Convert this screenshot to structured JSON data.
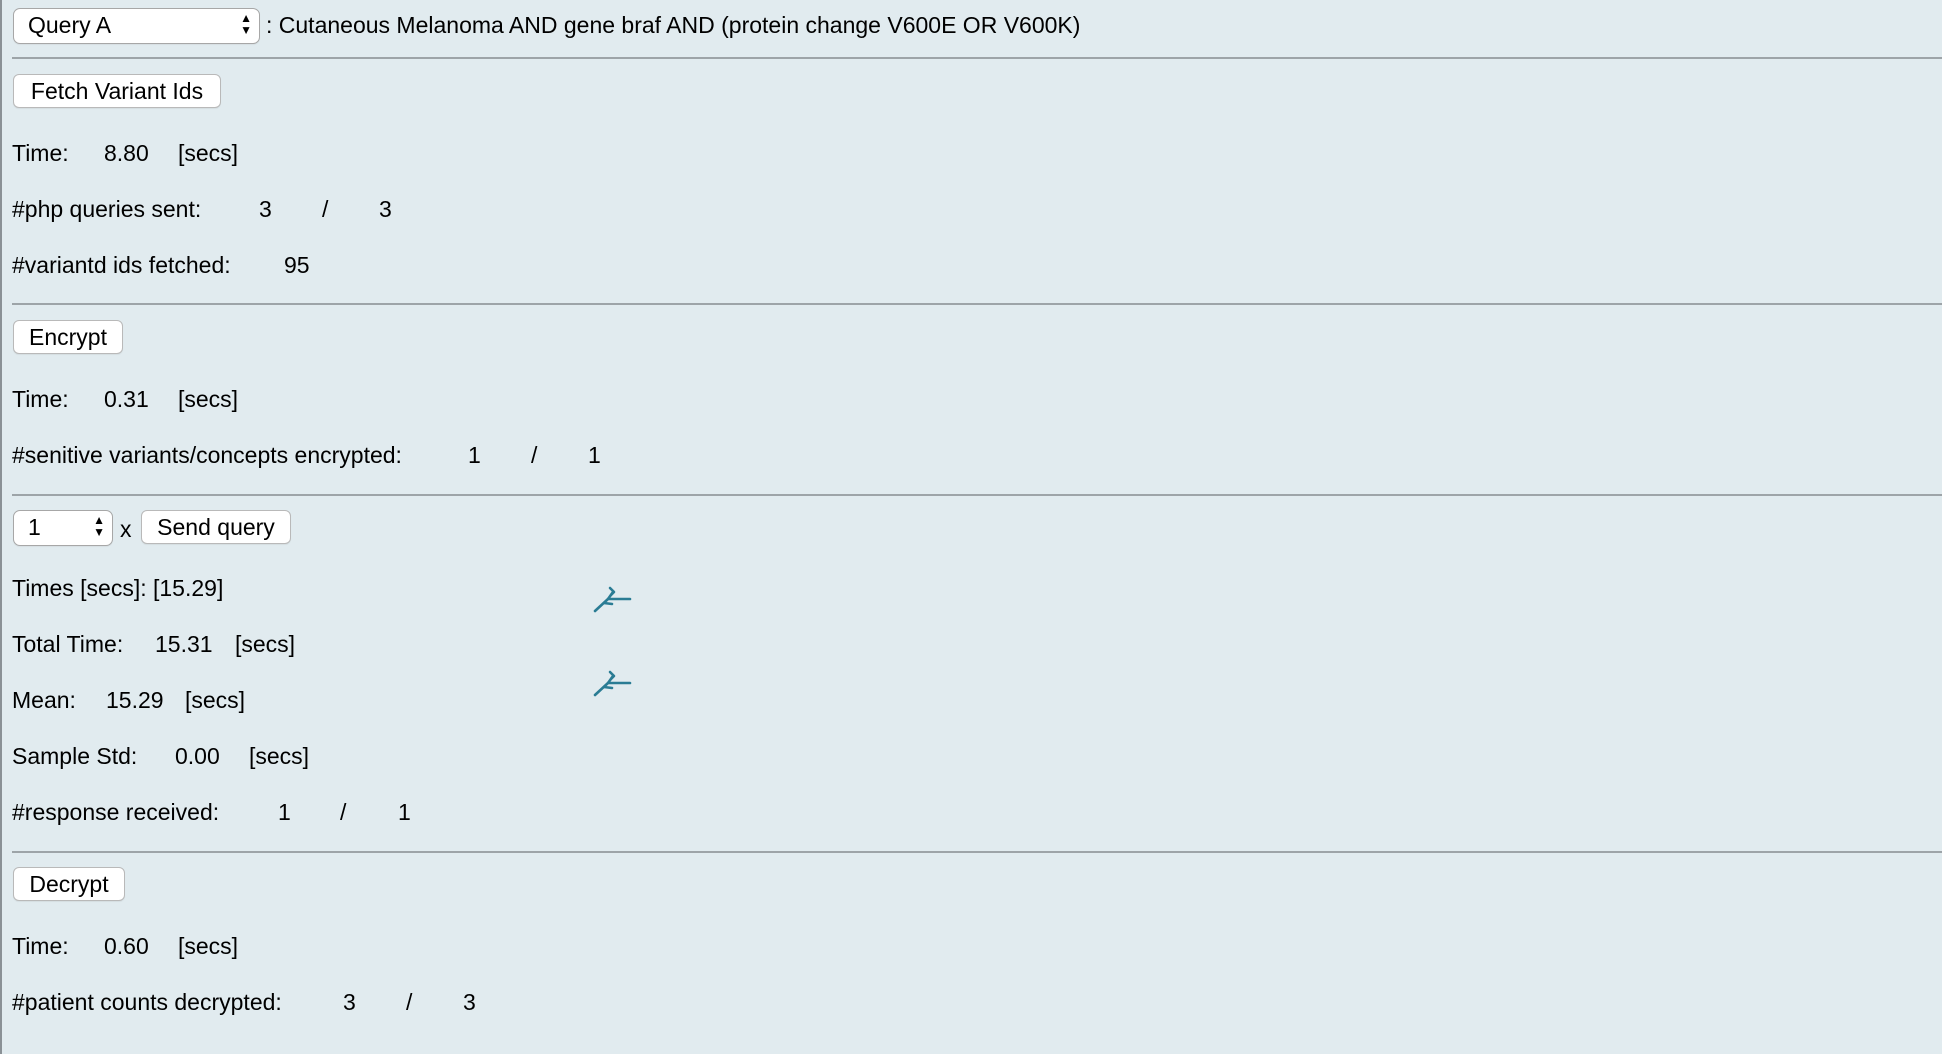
{
  "query_select": {
    "value": "Query A",
    "description": ": Cutaneous Melanoma AND gene braf AND (protein change V600E OR V600K)"
  },
  "fetch": {
    "button_label": "Fetch Variant Ids",
    "time_label": "Time:",
    "time_value": "8.80",
    "time_unit": "[secs]",
    "php_label": "#php queries sent:",
    "php_done": "3",
    "php_sep": "/",
    "php_total": "3",
    "ids_label": "#variantd ids fetched:",
    "ids_value": "95"
  },
  "encrypt": {
    "button_label": "Encrypt",
    "time_label": "Time:",
    "time_value": "0.31",
    "time_unit": "[secs]",
    "sens_label": "#senitive variants/concepts encrypted:",
    "sens_done": "1",
    "sens_sep": "/",
    "sens_total": "1"
  },
  "send": {
    "repeat_value": "1",
    "times_sign": "x",
    "button_label": "Send query",
    "times_text": "Times [secs]: [15.29]",
    "total_label": "Total Time:",
    "total_value": "15.31",
    "total_unit": "[secs]",
    "mean_label": "Mean:",
    "mean_value": "15.29",
    "mean_unit": "[secs]",
    "std_label": "Sample Std:",
    "std_value": "0.00",
    "std_unit": "[secs]",
    "resp_label": "#response received:",
    "resp_done": "1",
    "resp_sep": "/",
    "resp_total": "1",
    "spinner_icon": "gazelle-icon",
    "spinner_color": "#2a7c94"
  },
  "decrypt": {
    "button_label": "Decrypt",
    "time_label": "Time:",
    "time_value": "0.60",
    "time_unit": "[secs]",
    "count_label": "#patient counts decrypted:",
    "count_done": "3",
    "count_sep": "/",
    "count_total": "3"
  },
  "icons": {
    "select_arrows": "updown-arrows-icon"
  }
}
